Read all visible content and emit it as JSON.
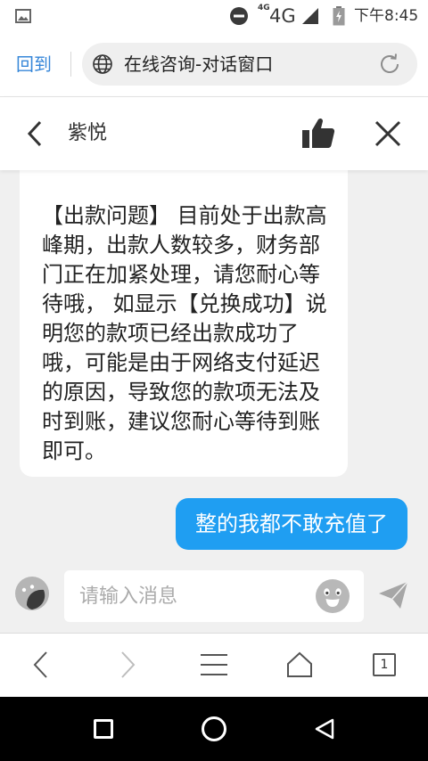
{
  "colors": {
    "accent_blue": "#1f9ef2",
    "link_blue": "#3787d9",
    "chat_background": "#f0f0f0",
    "bubble_white": "#ffffff",
    "system_nav": "#000000"
  },
  "status_bar": {
    "left_icon": "gallery-icon",
    "status_icons": [
      "do-not-disturb-icon",
      "signal-icon",
      "battery-charging-icon"
    ],
    "network_small": "4G",
    "network": "4G",
    "time": "下午8:45"
  },
  "browser_bar": {
    "back_link": "回到",
    "site_icon": "globe-icon",
    "page_title": "在线咨询-对话窗口",
    "reload_icon": "refresh-icon"
  },
  "chat_header": {
    "back_icon": "chevron-left-icon",
    "contact_name": "紫悦",
    "like_icon": "thumbs-up-icon",
    "close_icon": "close-icon"
  },
  "agent_message": {
    "lines": [
      "【出款问题】 目前处于出款高",
      "峰期，出款人数较多，财务部",
      "门正在加紧处理，请您耐心等",
      "待哦， 如显示【兑换成功】说",
      "明您的款项已经出款成功了",
      "哦，可能是由于网络支付延迟",
      "的原因，导致您的款项无法及",
      "时到账，建议您耐心等待到账",
      "即可。"
    ]
  },
  "user_message": {
    "text": "整的我都不敢充值了"
  },
  "composer": {
    "mode_icon": "chat-avatar-icon",
    "value": "",
    "placeholder": "请输入消息",
    "emoji_icon": "emoji-icon",
    "send_icon": "send-icon"
  },
  "browser_toolbar": {
    "icons": [
      "back-icon",
      "forward-icon",
      "menu-icon",
      "home-icon",
      "tabs-icon"
    ],
    "tab_count": "1"
  },
  "system_nav": {
    "icons": [
      "recent-apps-icon",
      "home-icon",
      "back-icon"
    ]
  }
}
